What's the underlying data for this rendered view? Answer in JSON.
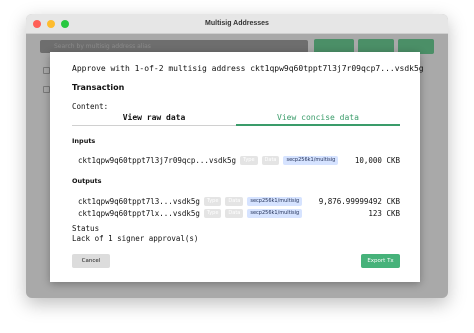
{
  "window": {
    "title": "Multisig Addresses"
  },
  "background": {
    "search_placeholder": "Search by multisig address alias"
  },
  "modal": {
    "approve_text": "Approve with 1-of-2 multisig address ckt1qpw9q60tppt7l3j7r09qcp7...vsdk5g",
    "section_title": "Transaction",
    "content_label": "Content:",
    "tabs": [
      {
        "label": "View raw data",
        "active": false
      },
      {
        "label": "View concise data",
        "active": true
      }
    ],
    "inputs_label": "Inputs",
    "inputs": [
      {
        "address": "ckt1qpw9q60tppt7l3j7r09qcp...vsdk5g",
        "chip1": "Type",
        "chip2": "Data",
        "lock": "secp256k1/multisig",
        "amount": "10,000 CKB"
      }
    ],
    "outputs_label": "Outputs",
    "outputs": [
      {
        "address": "ckt1qpw9q60tppt7l3...vsdk5g",
        "chip1": "Type",
        "chip2": "Data",
        "lock": "secp256k1/multisig",
        "amount": "9,876.99999492 CKB"
      },
      {
        "address": "ckt1qpw9q60tppt7lx...vsdk5g",
        "chip1": "Type",
        "chip2": "Data",
        "lock": "secp256k1/multisig",
        "amount": "123 CKB"
      }
    ],
    "status_label": "Status",
    "status_value": "Lack of 1 signer approval(s)",
    "cancel_label": "Cancel",
    "export_label": "Export Tx"
  },
  "colors": {
    "accent": "#3a9c6a",
    "export": "#46b27a",
    "chip_blue": "#d6e3ff"
  }
}
